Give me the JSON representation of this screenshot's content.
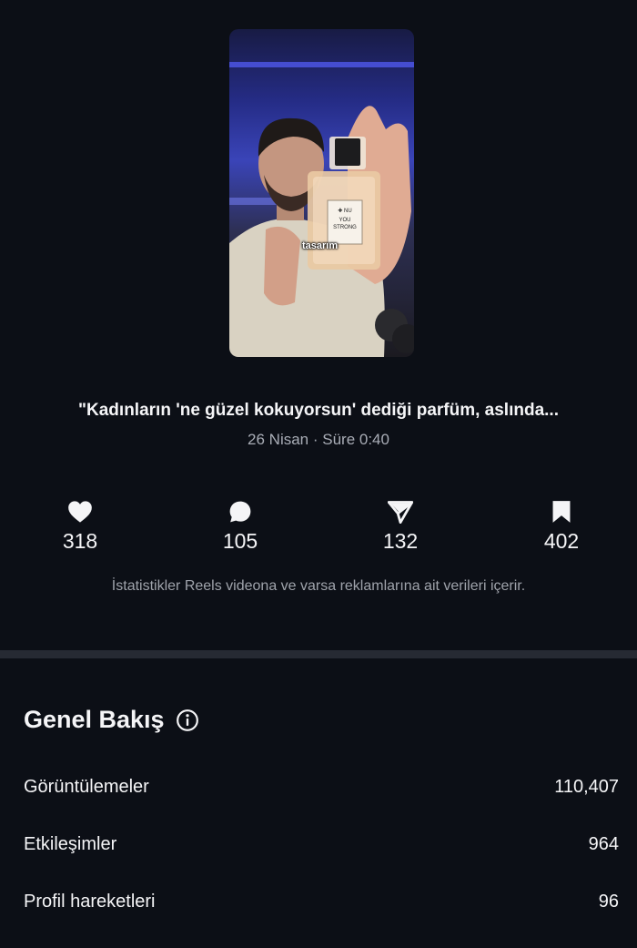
{
  "reel": {
    "thumbnail_caption": "tasarım",
    "bottle_label": [
      "✚ NU",
      "YOU",
      "STRONG"
    ],
    "title": "\"Kadınların 'ne güzel kokuyorsun' dediği parfüm, aslında...",
    "meta": "26 Nisan · Süre 0:40"
  },
  "stats": {
    "likes": "318",
    "comments": "105",
    "shares": "132",
    "saves": "402",
    "note": "İstatistikler Reels videona ve varsa reklamlarına ait verileri içerir."
  },
  "overview": {
    "heading": "Genel Bakış",
    "rows": [
      {
        "label": "Görüntülemeler",
        "value": "110,407"
      },
      {
        "label": "Etkileşimler",
        "value": "964"
      },
      {
        "label": "Profil hareketleri",
        "value": "96"
      }
    ]
  },
  "icons": [
    "heart-icon",
    "comment-icon",
    "share-icon",
    "bookmark-icon",
    "info-icon"
  ],
  "colors": {
    "background": "#0c0f16",
    "divider": "#262a33",
    "muted_text": "#a9adb6"
  }
}
